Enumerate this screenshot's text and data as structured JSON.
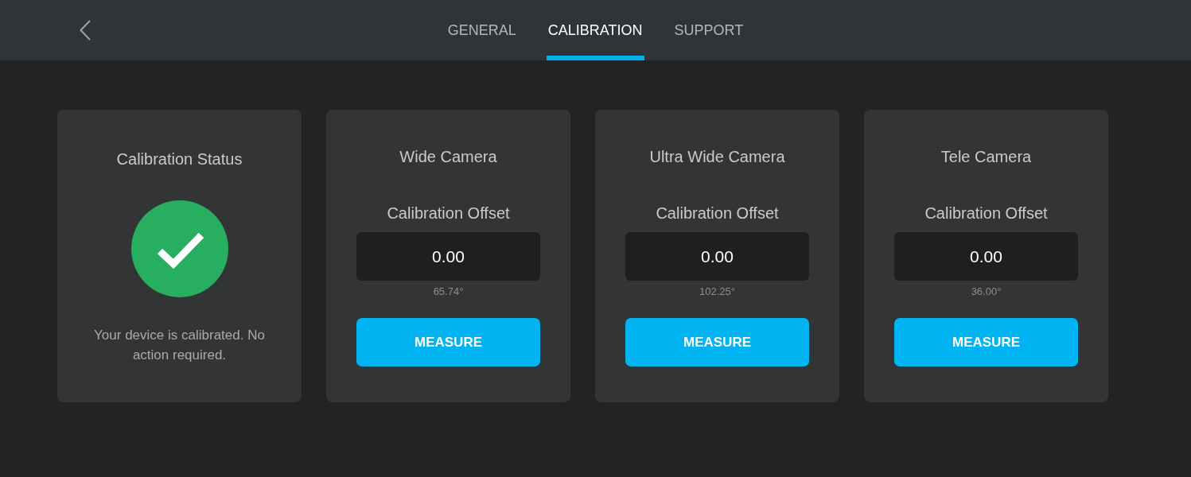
{
  "tabs": [
    {
      "label": "GENERAL",
      "selected": false
    },
    {
      "label": "CALIBRATION",
      "selected": true
    },
    {
      "label": "SUPPORT",
      "selected": false
    }
  ],
  "status_card": {
    "title": "Calibration Status",
    "calibrated": true,
    "message": "Your device is calibrated. No action required."
  },
  "cameras": [
    {
      "title": "Wide Camera",
      "offset_label": "Calibration Offset",
      "offset_value": "0.00",
      "reading": "65.74°",
      "button": "MEASURE"
    },
    {
      "title": "Ultra Wide Camera",
      "offset_label": "Calibration Offset",
      "offset_value": "0.00",
      "reading": "102.25°",
      "button": "MEASURE"
    },
    {
      "title": "Tele Camera",
      "offset_label": "Calibration Offset",
      "offset_value": "0.00",
      "reading": "36.00°",
      "button": "MEASURE"
    }
  ]
}
